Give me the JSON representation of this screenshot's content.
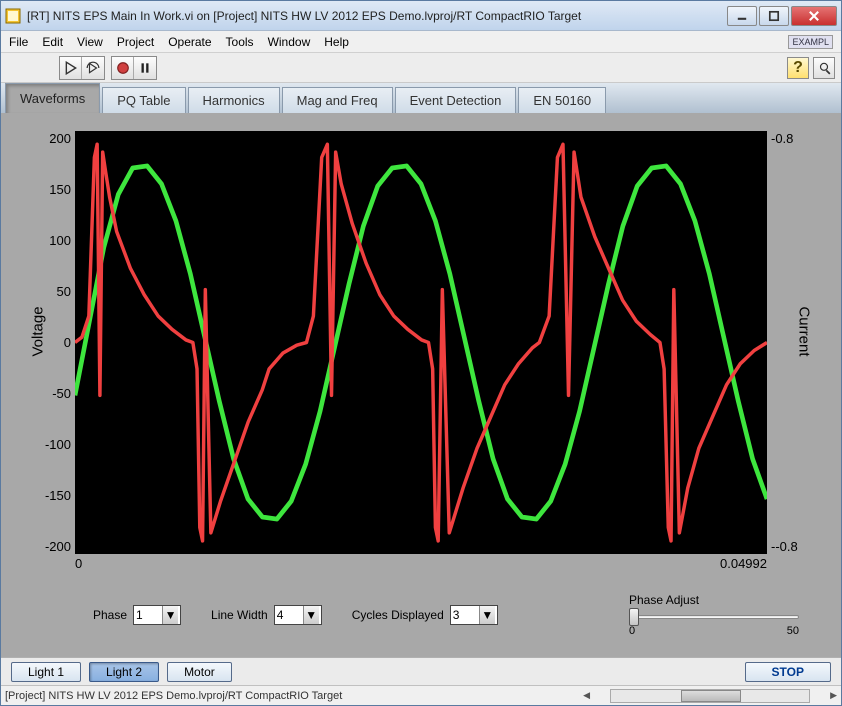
{
  "window": {
    "title": "[RT] NITS EPS Main In Work.vi on [Project] NITS HW LV 2012 EPS Demo.lvproj/RT CompactRIO Target"
  },
  "menu": {
    "items": [
      "File",
      "Edit",
      "View",
      "Project",
      "Operate",
      "Tools",
      "Window",
      "Help"
    ],
    "example_badge": "EXAMPL"
  },
  "toolbar": {
    "run_icon": "run-arrow",
    "run_cont_icon": "run-continuous",
    "record_icon": "record",
    "pause_icon": "pause",
    "help_icon": "?",
    "search_icon": "find"
  },
  "tabs": {
    "items": [
      "Waveforms",
      "PQ Table",
      "Harmonics",
      "Mag and Freq",
      "Event Detection",
      "EN 50160"
    ],
    "active_index": 0
  },
  "chart": {
    "y_left_label": "Voltage",
    "y_right_label": "Current",
    "y_left_ticks": [
      "200",
      "150",
      "100",
      "50",
      "0",
      "-50",
      "-100",
      "-150",
      "-200"
    ],
    "y_right_ticks_top": "-0.8",
    "y_right_ticks_bottom": "--0.8",
    "x_min": "0",
    "x_max": "0.04992"
  },
  "chart_data": {
    "type": "line",
    "xlim": [
      0,
      0.04992
    ],
    "title": "",
    "xlabel": "",
    "series": [
      {
        "name": "Voltage",
        "color": "#3ee63e",
        "axis": "left",
        "ylabel": "Voltage",
        "ylim": [
          -200,
          200
        ],
        "x": [
          0,
          0.00104,
          0.00208,
          0.00312,
          0.00416,
          0.0052,
          0.00624,
          0.00728,
          0.00832,
          0.00936,
          0.0104,
          0.01144,
          0.01248,
          0.01352,
          0.01456,
          0.0156,
          0.01664,
          0.01768,
          0.01872,
          0.01976,
          0.0208,
          0.02184,
          0.02288,
          0.02392,
          0.02496,
          0.026,
          0.02704,
          0.02808,
          0.02912,
          0.03016,
          0.0312,
          0.03224,
          0.03328,
          0.03432,
          0.03536,
          0.0364,
          0.03744,
          0.03848,
          0.03952,
          0.04056,
          0.0416,
          0.04264,
          0.04368,
          0.04472,
          0.04576,
          0.0468,
          0.04784,
          0.04888,
          0.04992
        ],
        "values": [
          -50,
          20,
          90,
          140,
          165,
          167,
          150,
          115,
          65,
          5,
          -55,
          -110,
          -148,
          -165,
          -167,
          -150,
          -115,
          -65,
          -5,
          55,
          110,
          148,
          165,
          167,
          150,
          115,
          65,
          5,
          -55,
          -110,
          -148,
          -165,
          -167,
          -150,
          -115,
          -65,
          -5,
          55,
          110,
          148,
          165,
          167,
          150,
          115,
          65,
          5,
          -55,
          -110,
          -148
        ]
      },
      {
        "name": "Current",
        "color": "#f04040",
        "axis": "right",
        "ylabel": "Current",
        "ylim": [
          -0.8,
          0.8
        ],
        "x": [
          0,
          0.0005,
          0.001,
          0.0014,
          0.0016,
          0.0018,
          0.002,
          0.0022,
          0.0025,
          0.003,
          0.004,
          0.005,
          0.006,
          0.007,
          0.008,
          0.0085,
          0.0088,
          0.009,
          0.0092,
          0.0094,
          0.0098,
          0.0105,
          0.0115,
          0.0125,
          0.0135,
          0.014,
          0.015,
          0.016,
          0.0167,
          0.0172,
          0.0178,
          0.0182,
          0.0185,
          0.0188,
          0.0192,
          0.02,
          0.021,
          0.022,
          0.023,
          0.024,
          0.025,
          0.0255,
          0.0258,
          0.026,
          0.0262,
          0.0265,
          0.027,
          0.028,
          0.029,
          0.03,
          0.031,
          0.032,
          0.033,
          0.0335,
          0.0342,
          0.0348,
          0.0352,
          0.0356,
          0.036,
          0.0365,
          0.0375,
          0.0385,
          0.0395,
          0.0405,
          0.0415,
          0.0422,
          0.0425,
          0.0428,
          0.043,
          0.0432,
          0.0436,
          0.0442,
          0.045,
          0.046,
          0.047,
          0.048,
          0.049,
          0.04992
        ],
        "values": [
          0,
          0.02,
          0.1,
          0.7,
          0.75,
          -0.2,
          0.72,
          0.65,
          0.55,
          0.42,
          0.28,
          0.18,
          0.1,
          0.05,
          0.01,
          0,
          -0.1,
          -0.7,
          -0.75,
          0.2,
          -0.72,
          -0.6,
          -0.45,
          -0.3,
          -0.18,
          -0.1,
          -0.04,
          -0.01,
          0,
          0.1,
          0.7,
          0.75,
          -0.2,
          0.72,
          0.6,
          0.45,
          0.3,
          0.18,
          0.1,
          0.05,
          0.01,
          0,
          -0.1,
          -0.7,
          -0.75,
          0.2,
          -0.72,
          -0.55,
          -0.4,
          -0.28,
          -0.16,
          -0.08,
          -0.02,
          0,
          0.1,
          0.7,
          0.75,
          -0.2,
          0.72,
          0.55,
          0.4,
          0.28,
          0.16,
          0.08,
          0.03,
          0,
          -0.1,
          -0.7,
          -0.75,
          0.2,
          -0.72,
          -0.55,
          -0.4,
          -0.28,
          -0.16,
          -0.08,
          -0.03,
          0
        ]
      }
    ]
  },
  "controls": {
    "phase_label": "Phase",
    "phase_value": "1",
    "linewidth_label": "Line Width",
    "linewidth_value": "4",
    "cycles_label": "Cycles Displayed",
    "cycles_value": "3",
    "phase_adjust_label": "Phase Adjust",
    "slider_min": "0",
    "slider_max": "50",
    "slider_value": 0
  },
  "bottom": {
    "light1": "Light 1",
    "light2": "Light 2",
    "motor": "Motor",
    "stop": "STOP"
  },
  "status": {
    "text": "[Project] NITS HW LV 2012 EPS Demo.lvproj/RT CompactRIO Target"
  }
}
